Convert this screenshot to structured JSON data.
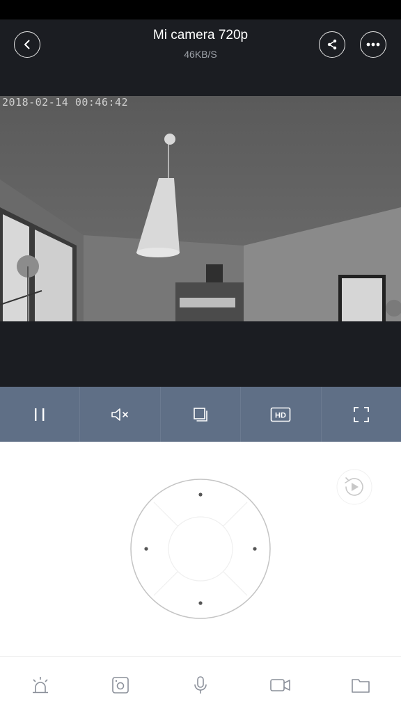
{
  "header": {
    "title": "Mi camera 720p",
    "bitrate": "46KB/S",
    "back_icon": "chevron-left-icon",
    "share_icon": "share-icon",
    "more_icon": "more-horizontal-icon"
  },
  "video": {
    "timestamp": "2018-02-14 00:46:42"
  },
  "toolbar": {
    "items": [
      {
        "name": "pause",
        "icon": "pause-icon"
      },
      {
        "name": "mute",
        "icon": "speaker-muted-icon"
      },
      {
        "name": "screenshot",
        "icon": "copy-frame-icon"
      },
      {
        "name": "hd",
        "icon": "hd-icon",
        "label": "HD"
      },
      {
        "name": "fullscreen",
        "icon": "fullscreen-icon"
      }
    ]
  },
  "controls": {
    "playback_icon": "replay-icon",
    "dpad_icon": "direction-pad-icon"
  },
  "bottom_nav": {
    "items": [
      {
        "name": "alarm",
        "icon": "alarm-light-icon"
      },
      {
        "name": "camera",
        "icon": "camera-snapshot-icon"
      },
      {
        "name": "microphone",
        "icon": "microphone-icon"
      },
      {
        "name": "record",
        "icon": "video-camera-icon"
      },
      {
        "name": "files",
        "icon": "folder-icon"
      }
    ]
  },
  "colors": {
    "header_bg": "#1b1d22",
    "toolbar_bg": "#5f6f86",
    "icon_gray": "#8a8f99"
  }
}
